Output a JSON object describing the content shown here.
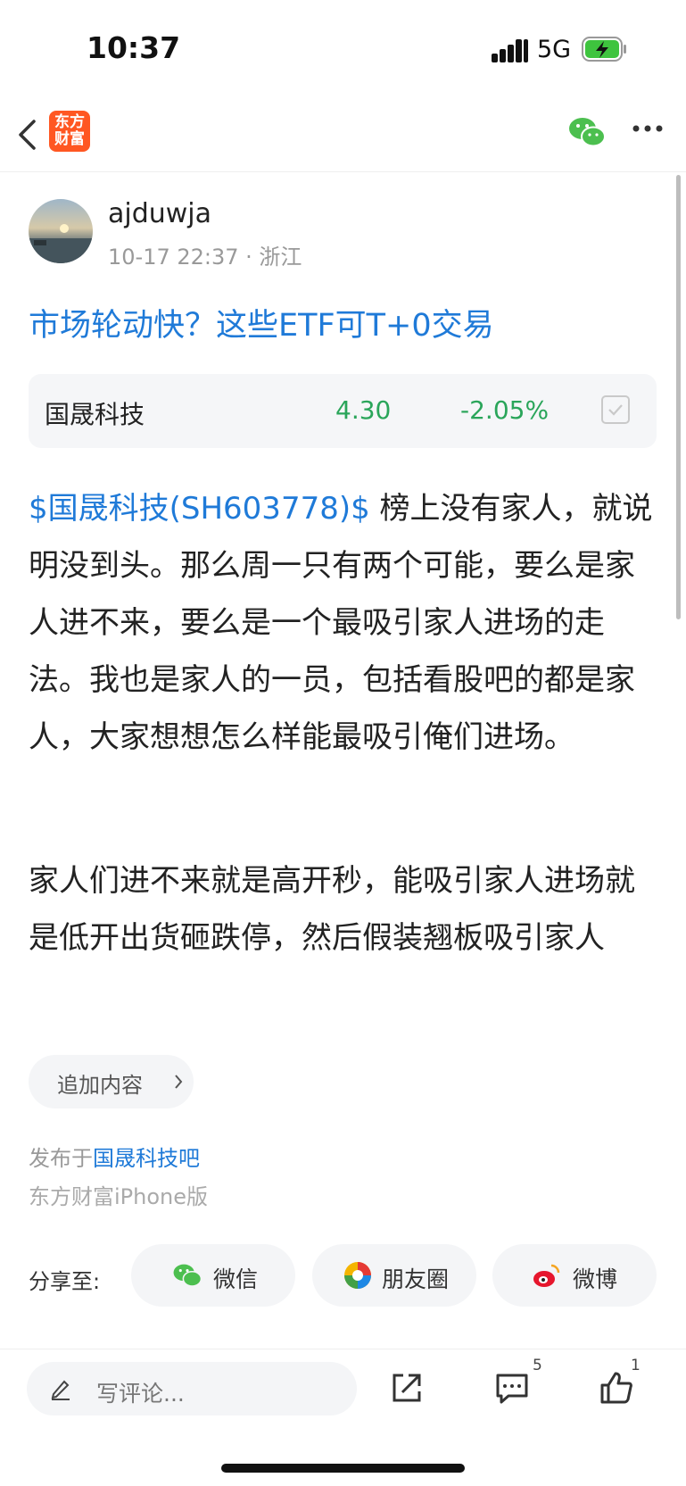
{
  "status_bar": {
    "time": "10:37",
    "network": "5G"
  },
  "nav": {
    "logo_line1": "东方",
    "logo_line2": "财富"
  },
  "post": {
    "author": "ajduwja",
    "meta": "10-17 22:37 · 浙江",
    "title": "市场轮动快？这些ETF可T+0交易",
    "stock": {
      "name": "国晟科技",
      "price": "4.30",
      "change": "-2.05%"
    },
    "stock_link": "$国晟科技(SH603778)$",
    "paragraph1_rest": "  榜上没有家人，就说明没到头。那么周一只有两个可能，要么是家人进不来，要么是一个最吸引家人进场的走法。我也是家人的一员，包括看股吧的都是家人，大家想想怎么样能最吸引俺们进场。",
    "paragraph2": "家人们进不来就是高开秒，能吸引家人进场就是低开出货砸跌停，然后假装翘板吸引家人",
    "append_label": "追加内容",
    "published_prefix": "发布于",
    "forum": "国晟科技吧",
    "client": "东方财富iPhone版"
  },
  "share": {
    "label": "分享至:",
    "wechat": "微信",
    "moments": "朋友圈",
    "weibo": "微博"
  },
  "bottom_bar": {
    "comment_placeholder": "写评论...",
    "comment_count": "5",
    "like_count": "1"
  },
  "colors": {
    "link": "#1f7ad8",
    "down": "#2aa55a",
    "brand": "#ff5722",
    "wechat": "#4cbf4f"
  },
  "icons": [
    "back-icon",
    "wechat-icon",
    "more-icon",
    "chevron-right-icon",
    "pencil-icon",
    "share-out-icon",
    "comment-icon",
    "thumbs-up-icon",
    "moments-icon",
    "weibo-icon"
  ]
}
